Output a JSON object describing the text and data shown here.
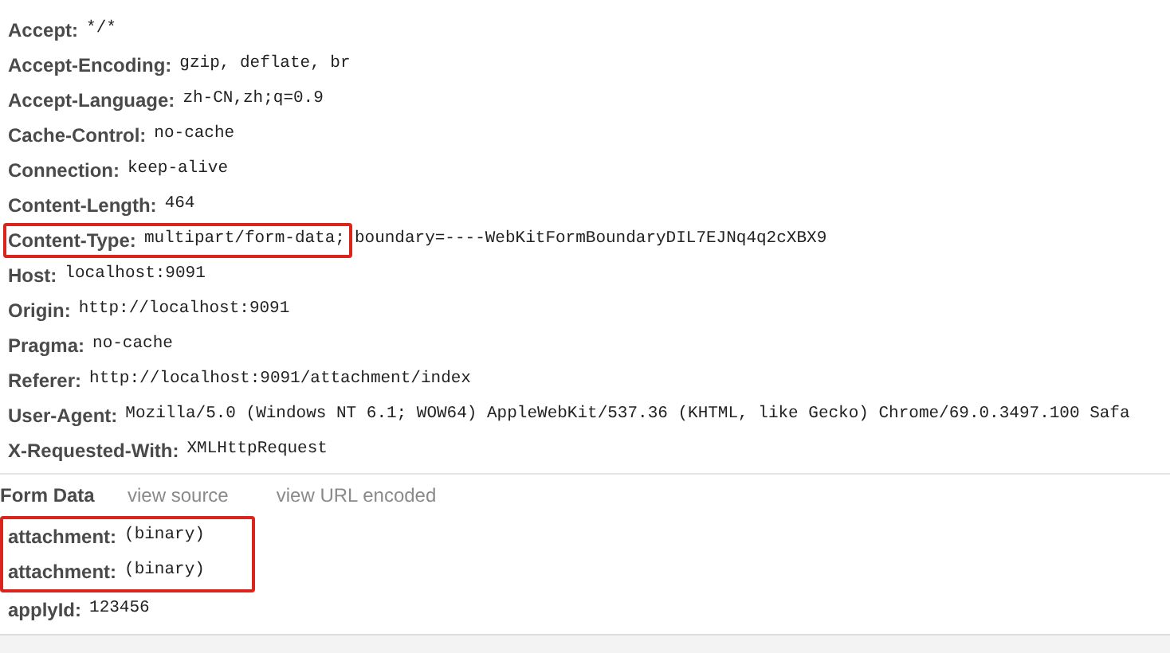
{
  "request_headers": [
    {
      "key": "Accept:",
      "value": "*/*",
      "highlighted": false
    },
    {
      "key": "Accept-Encoding:",
      "value": "gzip, deflate, br",
      "highlighted": false
    },
    {
      "key": "Accept-Language:",
      "value": "zh-CN,zh;q=0.9",
      "highlighted": false
    },
    {
      "key": "Cache-Control:",
      "value": "no-cache",
      "highlighted": false
    },
    {
      "key": "Connection:",
      "value": "keep-alive",
      "highlighted": false
    },
    {
      "key": "Content-Length:",
      "value": "464",
      "highlighted": false
    },
    {
      "key": "Content-Type:",
      "value": "multipart/form-data;",
      "value_continued": "boundary=----WebKitFormBoundaryDIL7EJNq4q2cXBX9",
      "highlighted": true
    },
    {
      "key": "Host:",
      "value": "localhost:9091",
      "highlighted": false
    },
    {
      "key": "Origin:",
      "value": "http://localhost:9091",
      "highlighted": false
    },
    {
      "key": "Pragma:",
      "value": "no-cache",
      "highlighted": false
    },
    {
      "key": "Referer:",
      "value": "http://localhost:9091/attachment/index",
      "highlighted": false
    },
    {
      "key": "User-Agent:",
      "value": "Mozilla/5.0 (Windows NT 6.1; WOW64) AppleWebKit/537.36 (KHTML, like Gecko) Chrome/69.0.3497.100 Safa",
      "highlighted": false
    },
    {
      "key": "X-Requested-With:",
      "value": "XMLHttpRequest",
      "highlighted": false
    }
  ],
  "form_data": {
    "title": "Form Data",
    "links": [
      "view source",
      "view URL encoded"
    ],
    "items": [
      {
        "key": "attachment:",
        "value": "(binary)",
        "highlighted": true
      },
      {
        "key": "attachment:",
        "value": "(binary)",
        "highlighted": true
      },
      {
        "key": "applyId:",
        "value": "123456",
        "highlighted": false
      }
    ]
  }
}
